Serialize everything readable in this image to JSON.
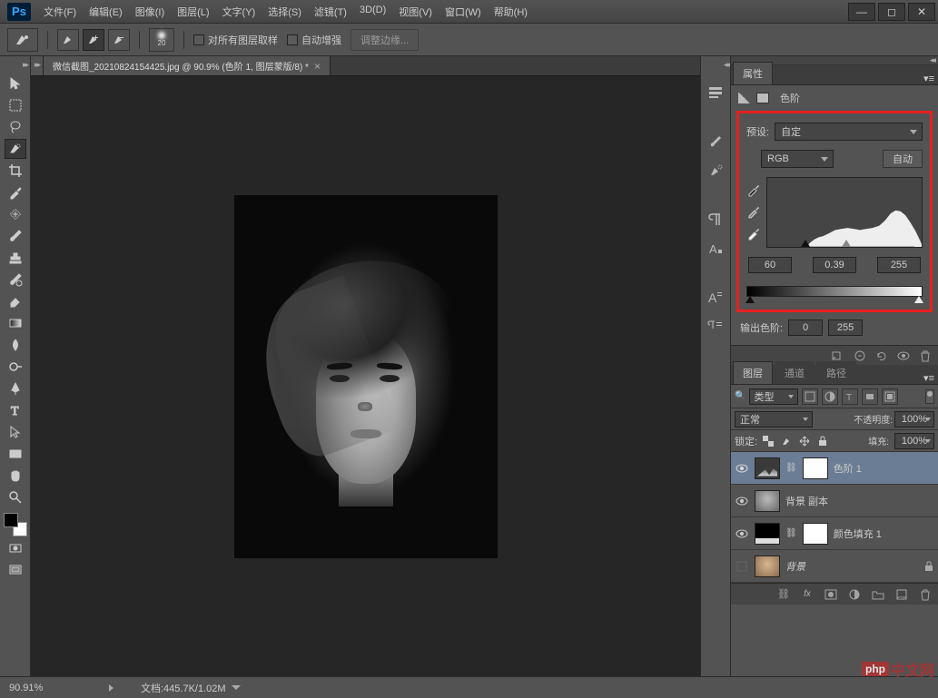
{
  "menu": {
    "items": [
      "文件(F)",
      "编辑(E)",
      "图像(I)",
      "图层(L)",
      "文字(Y)",
      "选择(S)",
      "滤镜(T)",
      "3D(D)",
      "视图(V)",
      "窗口(W)",
      "帮助(H)"
    ]
  },
  "optbar": {
    "brush_size": "20",
    "sample_all": "对所有图层取样",
    "auto_enhance": "自动增强",
    "refine_edge": "调整边缘..."
  },
  "doc": {
    "tab": "微信截图_20210824154425.jpg @ 90.9% (色阶 1, 图层蒙版/8) *"
  },
  "status": {
    "zoom": "90.91%",
    "docinfo": "文档:445.7K/1.02M"
  },
  "props": {
    "tab": "属性",
    "title": "色阶",
    "preset_label": "预设:",
    "preset_value": "自定",
    "channel": "RGB",
    "auto": "自动",
    "in_black": "60",
    "in_gamma": "0.39",
    "in_white": "255",
    "out_label": "输出色阶:",
    "out_black": "0",
    "out_white": "255"
  },
  "layers": {
    "tabs": [
      "图层",
      "通道",
      "路径"
    ],
    "filter_type": "类型",
    "blend_mode": "正常",
    "opacity_label": "不透明度:",
    "opacity": "100%",
    "lock_label": "锁定:",
    "fill_label": "填充:",
    "fill": "100%",
    "items": [
      {
        "name": "色阶 1"
      },
      {
        "name": "背景 副本"
      },
      {
        "name": "颜色填充 1"
      },
      {
        "name": "背景"
      }
    ]
  },
  "watermark": "中文网"
}
